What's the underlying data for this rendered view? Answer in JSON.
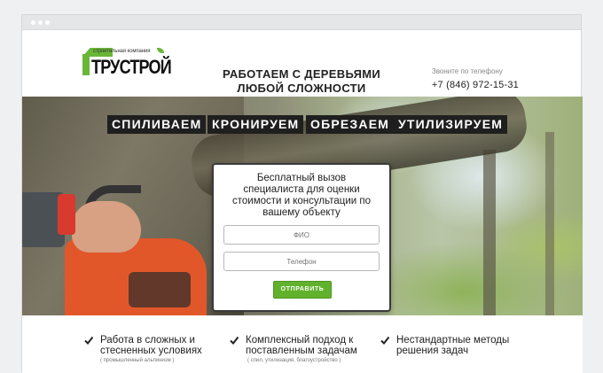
{
  "logo": {
    "small_text": "строительная компания",
    "name": "ТРУСТРОЙ"
  },
  "header": {
    "headline_line1": "РАБОТАЕМ С ДЕРЕВЬЯМИ",
    "headline_line2": "ЛЮБОЙ СЛОЖНОСТИ",
    "call_label": "Звоните по телефону",
    "phone": "+7 (846) 972-15-31"
  },
  "hero": {
    "services": [
      "СПИЛИВАЕМ",
      "КРОНИРУЕМ",
      "ОБРЕЗАЕМ",
      "УТИЛИЗИРУЕМ"
    ]
  },
  "form": {
    "title_line1": "Бесплатный вызов",
    "title_line2": "специалиста для оценки",
    "title_line3": "стоимости и консультации по",
    "title_line4": "вашему объекту",
    "name_placeholder": "ФИО",
    "phone_placeholder": "Телефон",
    "submit_label": "ОТПРАВИТЬ"
  },
  "features": [
    {
      "line1": "Работа в сложных и",
      "line2": "стесненных условиях",
      "sub": "( промышленный альпинизм )"
    },
    {
      "line1": "Комплексный подход к",
      "line2": "поставленным задачам",
      "sub": "( спил, утилизация, благоустройство )"
    },
    {
      "line1": "Нестандартные методы",
      "line2": "решения задач",
      "sub": ""
    }
  ],
  "colors": {
    "accent": "#61b12c",
    "tag_bg": "#1f1f1f"
  }
}
